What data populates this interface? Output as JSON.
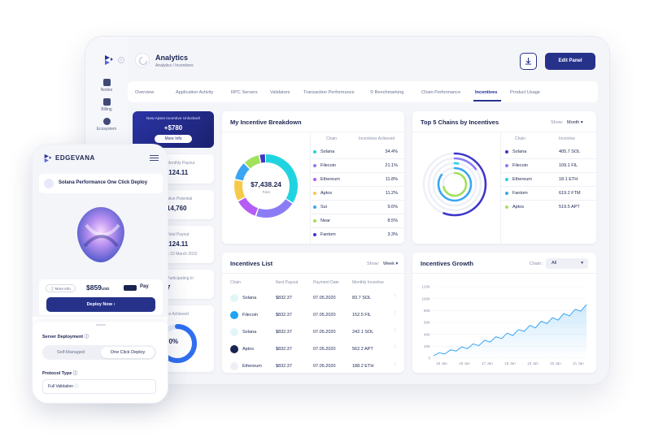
{
  "app": {
    "title": "Analytics",
    "breadcrumb": "Analytics / Incentives",
    "edit_label": "Edit Panel"
  },
  "sidebar": {
    "items": [
      {
        "label": "Nodes"
      },
      {
        "label": "Billing"
      },
      {
        "label": "Ecosystem"
      }
    ]
  },
  "tabs": [
    {
      "label": "Overview"
    },
    {
      "label": "Application Activity"
    },
    {
      "label": "RPC Servers"
    },
    {
      "label": "Validators"
    },
    {
      "label": "Transaction Performance"
    },
    {
      "label": "Benchmarking"
    },
    {
      "label": "Chain Performance"
    },
    {
      "label": "Incentives",
      "active": true
    },
    {
      "label": "Product Usage"
    }
  ],
  "promo": {
    "title": "New Aptos Incentive Unlocked!",
    "value": "+$780",
    "button": "More Info"
  },
  "stats": [
    {
      "label": "Monthly Payout",
      "value": ",124.11"
    },
    {
      "label": "ntive Potential",
      "value": "14,760"
    },
    {
      "label": "Total Payout",
      "value": ",124.11",
      "sub": "e 22 March 2022"
    },
    {
      "label": "Participating In",
      "value": "7"
    },
    {
      "label": "es Achieved",
      "value": "70%"
    }
  ],
  "breakdown": {
    "title": "My Incentive Breakdown",
    "center_value": "$7,438.24",
    "center_label": "Total",
    "col_chain": "Chain",
    "col_achieved": "Incentives Achieved",
    "rows": [
      {
        "chain": "Solana",
        "value": "34.4%",
        "color": "#1fd4e0"
      },
      {
        "chain": "Filecoin",
        "value": "21.1%",
        "color": "#8b7cf6"
      },
      {
        "chain": "Ethereum",
        "value": "11.8%",
        "color": "#b45cf4"
      },
      {
        "chain": "Aptos",
        "value": "11.2%",
        "color": "#f7c948"
      },
      {
        "chain": "Sui",
        "value": "9.6%",
        "color": "#3aa6f2"
      },
      {
        "chain": "Near",
        "value": "8.5%",
        "color": "#a3e05b"
      },
      {
        "chain": "Fantom",
        "value": "3.3%",
        "color": "#3d37c9"
      }
    ]
  },
  "top5": {
    "title": "Top 5 Chains by Incentives",
    "show_label": "Show:",
    "show_value": "Month",
    "col_chain": "Chain",
    "col_incentive": "Incentive",
    "rows": [
      {
        "chain": "Solana",
        "value": "405.7 SOL",
        "color": "#3d37c9"
      },
      {
        "chain": "Filecoin",
        "value": "109.1 FIL",
        "color": "#8b7cf6"
      },
      {
        "chain": "Ethereum",
        "value": "18.1 ETH",
        "color": "#1fd4e0"
      },
      {
        "chain": "Fantom",
        "value": "619.2 FTM",
        "color": "#3aa6f2"
      },
      {
        "chain": "Aptos",
        "value": "519.5 APT",
        "color": "#a3e05b"
      }
    ]
  },
  "list": {
    "title": "Incentives List",
    "show_label": "Show:",
    "show_value": "Week",
    "headers": [
      "Chain",
      "Next Payout",
      "Payment Date",
      "Monthly Incentive"
    ],
    "rows": [
      {
        "chain": "Solana",
        "payout": "$832.37",
        "date": "07.05.2020",
        "monthly": "83.7 SOL",
        "icon": "solana-icon"
      },
      {
        "chain": "Filecoin",
        "payout": "$832.37",
        "date": "07.05.2020",
        "monthly": "152.5 FIL",
        "icon": "filecoin-icon"
      },
      {
        "chain": "Solana",
        "payout": "$832.37",
        "date": "07.05.2020",
        "monthly": "242.1 SOL",
        "icon": "solana-icon"
      },
      {
        "chain": "Aptos",
        "payout": "$832.37",
        "date": "07.05.2020",
        "monthly": "562.2 APT",
        "icon": "aptos-icon"
      },
      {
        "chain": "Ethereum",
        "payout": "$832.37",
        "date": "07.05.2020",
        "monthly": "188.2 ETH",
        "icon": "ethereum-icon"
      }
    ]
  },
  "growth": {
    "title": "Incentives Growth",
    "chain_label": "Chain:",
    "chain_value": "All"
  },
  "chart_data": {
    "type": "area",
    "title": "Incentives Growth",
    "x": [
      "15 Jan",
      "16 Jan",
      "17 Jan",
      "18 Jan",
      "19 Jan",
      "20 Jan",
      "21 Jan"
    ],
    "yticks": [
      "0",
      "20K",
      "40K",
      "60K",
      "80K",
      "100K",
      "120K"
    ],
    "ylim": [
      0,
      120000
    ],
    "values": [
      4000,
      9000,
      7000,
      14000,
      12000,
      19000,
      16000,
      24000,
      21000,
      30000,
      27000,
      36000,
      33000,
      42000,
      38000,
      48000,
      45000,
      55000,
      51000,
      62000,
      58000,
      68000,
      64000,
      75000,
      71000,
      82000,
      79000,
      90000
    ],
    "color": "#3aa6f2"
  },
  "phone": {
    "brand": "EDGEVANA",
    "deploy_title": "Solana Performance One Click Deploy",
    "more_info": "More Info",
    "price": "$859",
    "price_unit": "USD",
    "pay_badge": "",
    "pay_label": "Pay",
    "deploy_button": "Deploy Now",
    "server_label": "Server Deployment",
    "seg_left": "Self-Managed",
    "seg_right": "One Click Deploy",
    "protocol_label": "Protocol Type",
    "protocol_value": "Full Validation"
  }
}
